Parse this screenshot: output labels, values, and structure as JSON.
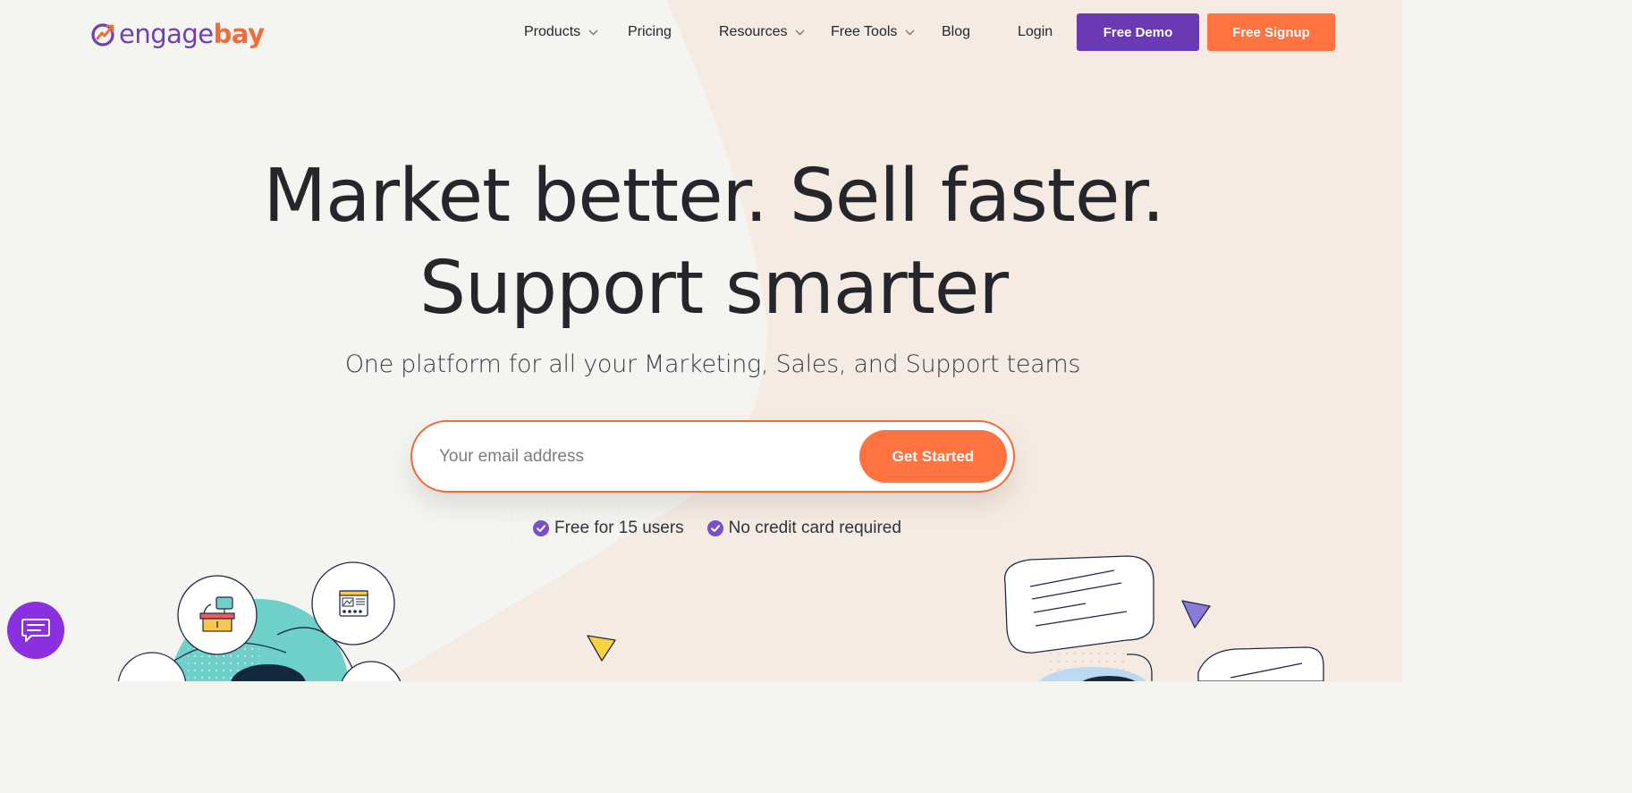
{
  "brand": {
    "logo_part1": "engage",
    "logo_part2": "bay"
  },
  "nav": {
    "items": [
      {
        "label": "Products",
        "dropdown": true
      },
      {
        "label": "Pricing",
        "dropdown": false
      },
      {
        "label": "Resources",
        "dropdown": true
      },
      {
        "label": "Free Tools",
        "dropdown": true
      },
      {
        "label": "Blog",
        "dropdown": false
      },
      {
        "label": "Login",
        "dropdown": false
      }
    ],
    "demo_label": "Free Demo",
    "signup_label": "Free Signup"
  },
  "hero": {
    "title_line1": "Market better. Sell faster.",
    "title_line2": "Support smarter",
    "subtitle": "One platform for all your Marketing, Sales, and Support teams",
    "email_placeholder": "Your email address",
    "cta_label": "Get Started",
    "perks": [
      "Free for 15 users",
      "No credit card required"
    ]
  },
  "colors": {
    "brand_purple": "#6a3ab5",
    "brand_orange": "#ff7340",
    "chat_purple": "#8b2fe0",
    "check_purple": "#7b4fc9"
  }
}
